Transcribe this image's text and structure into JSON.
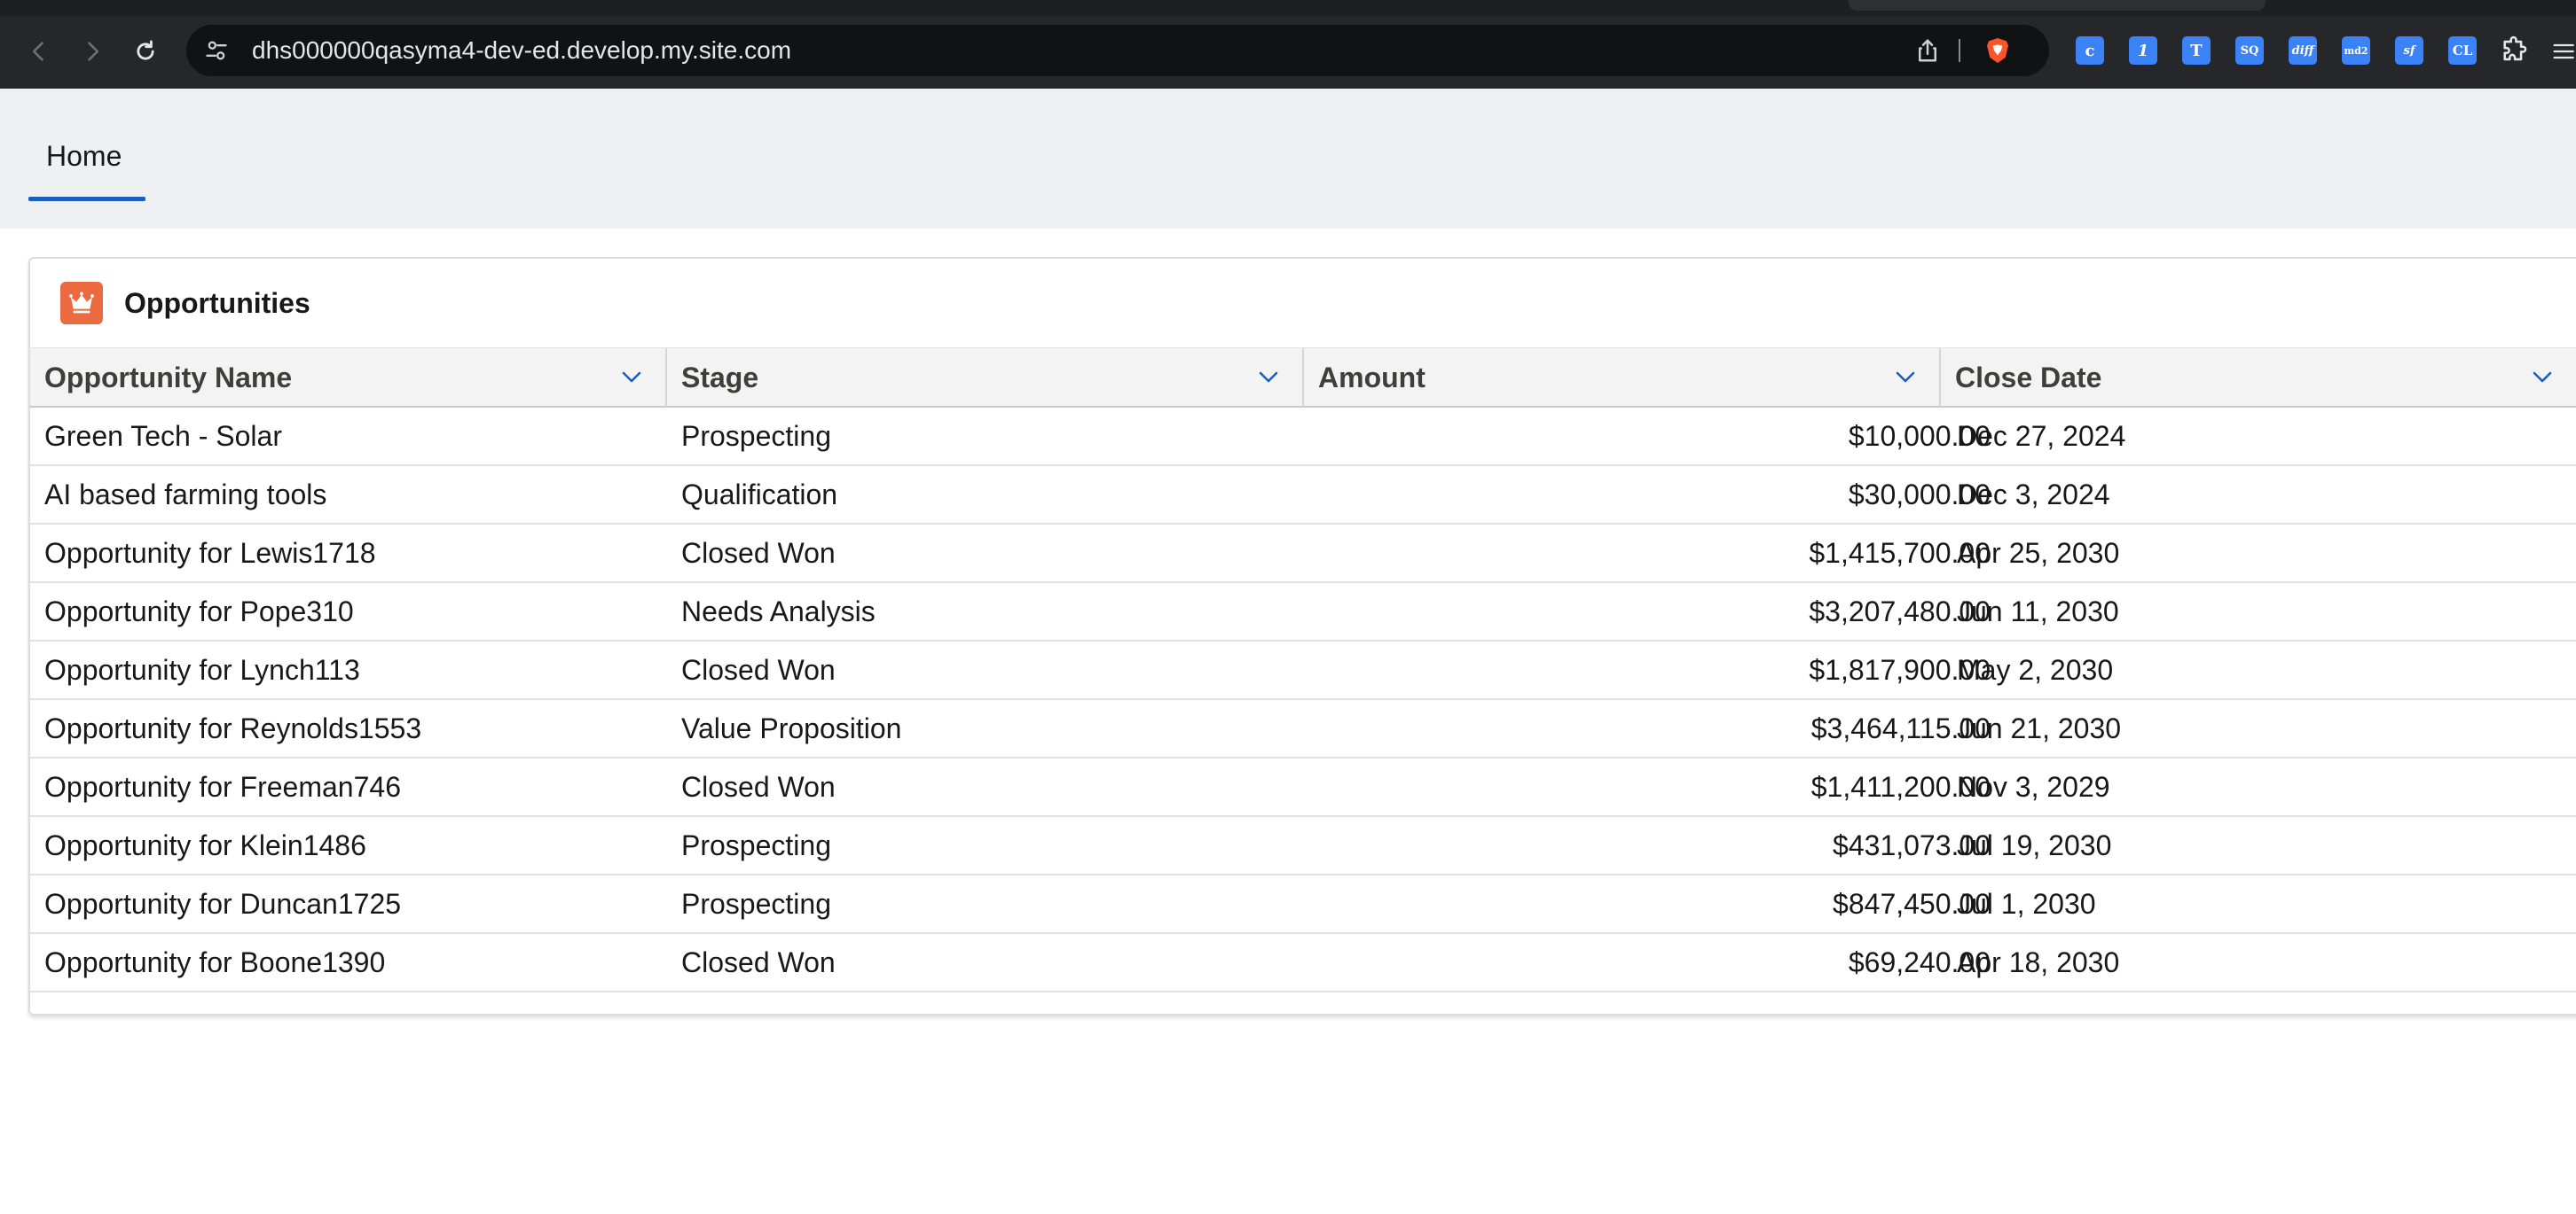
{
  "browser": {
    "url": "dhs000000qasyma4-dev-ed.develop.my.site.com",
    "extensions": [
      {
        "icon": "c-extension-icon",
        "glyph": "c"
      },
      {
        "icon": "1password-icon",
        "glyph": "1"
      },
      {
        "icon": "t-extension-icon",
        "glyph": "T"
      },
      {
        "icon": "sq-extension-icon",
        "glyph": "SQ"
      },
      {
        "icon": "diff-extension-icon",
        "glyph": "diff"
      },
      {
        "icon": "md2-extension-icon",
        "glyph": "md2"
      },
      {
        "icon": "sf-extension-icon",
        "glyph": "sf"
      },
      {
        "icon": "cl-extension-icon",
        "glyph": "CL"
      }
    ],
    "accent": "#3b82f6"
  },
  "header": {
    "home_tab": "Home",
    "accent": "#1b5fbe"
  },
  "card": {
    "title": "Opportunities",
    "icon": "crown-icon",
    "icon_color": "#ec6a3f"
  },
  "table": {
    "columns": [
      "Opportunity Name",
      "Stage",
      "Amount",
      "Close Date"
    ],
    "rows": [
      {
        "name": "Green Tech - Solar",
        "stage": "Prospecting",
        "amount": "$10,000.00",
        "close_date": "Dec 27, 2024"
      },
      {
        "name": "AI based farming tools",
        "stage": "Qualification",
        "amount": "$30,000.00",
        "close_date": "Dec 3, 2024"
      },
      {
        "name": "Opportunity for Lewis1718",
        "stage": "Closed Won",
        "amount": "$1,415,700.00",
        "close_date": "Apr 25, 2030"
      },
      {
        "name": "Opportunity for Pope310",
        "stage": "Needs Analysis",
        "amount": "$3,207,480.00",
        "close_date": "Jun 11, 2030"
      },
      {
        "name": "Opportunity for Lynch113",
        "stage": "Closed Won",
        "amount": "$1,817,900.00",
        "close_date": "May 2, 2030"
      },
      {
        "name": "Opportunity for Reynolds1553",
        "stage": "Value Proposition",
        "amount": "$3,464,115.00",
        "close_date": "Jun 21, 2030"
      },
      {
        "name": "Opportunity for Freeman746",
        "stage": "Closed Won",
        "amount": "$1,411,200.00",
        "close_date": "Nov 3, 2029"
      },
      {
        "name": "Opportunity for Klein1486",
        "stage": "Prospecting",
        "amount": "$431,073.00",
        "close_date": "Jul 19, 2030"
      },
      {
        "name": "Opportunity for Duncan1725",
        "stage": "Prospecting",
        "amount": "$847,450.00",
        "close_date": "Jul 1, 2030"
      },
      {
        "name": "Opportunity for Boone1390",
        "stage": "Closed Won",
        "amount": "$69,240.00",
        "close_date": "Apr 18, 2030"
      }
    ]
  }
}
